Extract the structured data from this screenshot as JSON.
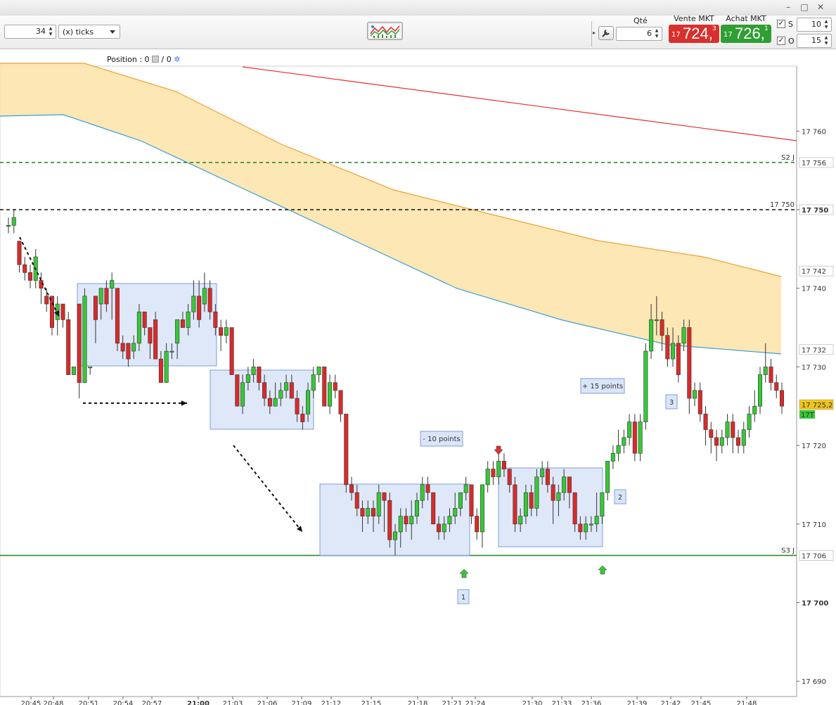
{
  "window": {
    "controls": [
      "–",
      "□",
      "✕"
    ]
  },
  "toolbar": {
    "interval_value": "34",
    "interval_unit": "(x) ticks",
    "qty_label": "Qté",
    "qty_value": "6",
    "sell": {
      "label": "Vente MKT",
      "prefix": "17",
      "main": "724,",
      "sup": "3",
      "color": "#d9302d"
    },
    "buy": {
      "label": "Achat MKT",
      "prefix": "17",
      "main": "726,",
      "sup": "1",
      "color": "#2f9e33"
    },
    "s_label": "S",
    "s_value": "10",
    "o_label": "O",
    "o_value": "15"
  },
  "position": {
    "text": "Position : 0",
    "separator": "/ 0"
  },
  "chart_data": {
    "type": "candlestick",
    "y_ticks": [
      17760,
      17750,
      17740,
      17730,
      17720,
      17710,
      17700,
      17690
    ],
    "y_tick_labels": [
      "17 760",
      "17 750",
      "17 740",
      "17 730",
      "17 720",
      "17 710",
      "17 700",
      "17 690"
    ],
    "x_tick_labels": [
      "20:45",
      "20:48",
      "20:51",
      "20:54",
      "20:57",
      "21:00",
      "21:03",
      "21:06",
      "21:09",
      "21:12",
      "21:15",
      "21:18",
      "21:21",
      "21:24",
      "21:30",
      "21:33",
      "21:36",
      "21:39",
      "21:42",
      "21:45",
      "21:48"
    ],
    "levels": [
      {
        "name": "S2 J",
        "value": 17756,
        "tag": "17 756",
        "color": "#2e8b2e",
        "style": "dashed"
      },
      {
        "name": "17 750",
        "value": 17750,
        "tag": "17 750",
        "color": "#111111",
        "style": "dashed"
      },
      {
        "name": "S3 J",
        "value": 17706,
        "tag": "17 706",
        "color": "#2e8b2e",
        "style": "solid"
      }
    ],
    "band_tags": [
      {
        "text": "17 742",
        "color": "#e8a33a"
      },
      {
        "text": "17 732",
        "color": "#3aa0d8"
      }
    ],
    "price_tag": {
      "text": "17 725,2",
      "sub": "17T"
    },
    "annotations": [
      "- 10 points",
      "+ 15 points",
      "1",
      "2",
      "3"
    ],
    "candles": [
      [
        17748,
        17748,
        17749,
        17747
      ],
      [
        17748,
        17749,
        17750,
        17747
      ],
      [
        17746,
        17743,
        17746,
        17742
      ],
      [
        17743,
        17742,
        17744,
        17741
      ],
      [
        17742,
        17741,
        17743,
        17740
      ],
      [
        17741,
        17744,
        17745,
        17740
      ],
      [
        17741,
        17740,
        17742,
        17738
      ],
      [
        17739,
        17738,
        17740,
        17737
      ],
      [
        17739,
        17735,
        17739,
        17734
      ],
      [
        17736,
        17738,
        17739,
        17734
      ],
      [
        17738,
        17736,
        17738,
        17735
      ],
      [
        17736,
        17729,
        17737,
        17729
      ],
      [
        17729,
        17730,
        17730,
        17729
      ],
      [
        17738,
        17728,
        17738,
        17726
      ],
      [
        17728,
        17739,
        17740,
        17728
      ],
      [
        17730,
        17730,
        17730,
        17729
      ],
      [
        17739,
        17736,
        17739,
        17733
      ],
      [
        17738,
        17740,
        17740,
        17736
      ],
      [
        17740,
        17738,
        17741,
        17737
      ],
      [
        17740,
        17741,
        17742,
        17736
      ],
      [
        17740,
        17733,
        17740,
        17732
      ],
      [
        17733,
        17732,
        17734,
        17731
      ],
      [
        17733,
        17731,
        17733,
        17730
      ],
      [
        17732,
        17733,
        17734,
        17731
      ],
      [
        17733,
        17737,
        17738,
        17732
      ],
      [
        17737,
        17735,
        17737,
        17734
      ],
      [
        17735,
        17733,
        17735,
        17731
      ],
      [
        17736,
        17731,
        17737,
        17731
      ],
      [
        17731,
        17728,
        17732,
        17728
      ],
      [
        17728,
        17732,
        17733,
        17728
      ],
      [
        17732,
        17732,
        17733,
        17731
      ],
      [
        17733,
        17736,
        17736,
        17731
      ],
      [
        17736,
        17735,
        17737,
        17735
      ],
      [
        17735,
        17737,
        17738,
        17734
      ],
      [
        17737,
        17739,
        17741,
        17736
      ],
      [
        17739,
        17736,
        17741,
        17735
      ],
      [
        17738,
        17740,
        17742,
        17737
      ],
      [
        17740,
        17737,
        17741,
        17736
      ],
      [
        17737,
        17735,
        17738,
        17734
      ],
      [
        17735,
        17734,
        17736,
        17732
      ],
      [
        17734,
        17735,
        17736,
        17733
      ],
      [
        17735,
        17729,
        17735,
        17729
      ],
      [
        17729,
        17725,
        17729,
        17725
      ],
      [
        17725,
        17728,
        17729,
        17724
      ],
      [
        17728,
        17729,
        17730,
        17727
      ],
      [
        17729,
        17730,
        17731,
        17728
      ],
      [
        17730,
        17728,
        17730,
        17727
      ],
      [
        17728,
        17726,
        17729,
        17725
      ],
      [
        17726,
        17725,
        17727,
        17724
      ],
      [
        17725,
        17726,
        17728,
        17725
      ],
      [
        17726,
        17727,
        17728,
        17725
      ],
      [
        17727,
        17728,
        17729,
        17726
      ],
      [
        17728,
        17726,
        17729,
        17726
      ],
      [
        17726,
        17724,
        17727,
        17723
      ],
      [
        17724,
        17723,
        17725,
        17722
      ],
      [
        17724,
        17727,
        17728,
        17723
      ],
      [
        17727,
        17729,
        17730,
        17726
      ],
      [
        17729,
        17730,
        17730,
        17728
      ],
      [
        17730,
        17725,
        17730,
        17725
      ],
      [
        17725,
        17728,
        17729,
        17724
      ],
      [
        17728,
        17727,
        17729,
        17726
      ],
      [
        17727,
        17724,
        17727,
        17723
      ],
      [
        17724,
        17715,
        17724,
        17714
      ],
      [
        17715,
        17714,
        17716,
        17713
      ],
      [
        17714,
        17712,
        17715,
        17711
      ],
      [
        17712,
        17711,
        17713,
        17709
      ],
      [
        17711,
        17712,
        17713,
        17710
      ],
      [
        17712,
        17711,
        17713,
        17709
      ],
      [
        17711,
        17714,
        17715,
        17710
      ],
      [
        17714,
        17713,
        17714,
        17709
      ],
      [
        17713,
        17708,
        17714,
        17707
      ],
      [
        17708,
        17709,
        17710,
        17706
      ],
      [
        17709,
        17711,
        17712,
        17707
      ],
      [
        17711,
        17710,
        17712,
        17709
      ],
      [
        17710,
        17711,
        17713,
        17708
      ],
      [
        17711,
        17713,
        17714,
        17710
      ],
      [
        17713,
        17715,
        17716,
        17712
      ],
      [
        17715,
        17714,
        17716,
        17713
      ],
      [
        17714,
        17710,
        17714,
        17710
      ],
      [
        17710,
        17709,
        17711,
        17708
      ],
      [
        17709,
        17710,
        17711,
        17708
      ],
      [
        17710,
        17711,
        17712,
        17709
      ],
      [
        17711,
        17712,
        17714,
        17710
      ],
      [
        17712,
        17714,
        17714,
        17711
      ],
      [
        17714,
        17715,
        17716,
        17713
      ],
      [
        17715,
        17711,
        17715,
        17710
      ],
      [
        17711,
        17709,
        17712,
        17708
      ],
      [
        17709,
        17715,
        17715,
        17707
      ],
      [
        17715,
        17717,
        17718,
        17714
      ],
      [
        17717,
        17716,
        17718,
        17715
      ],
      [
        17716,
        17718,
        17719,
        17715
      ],
      [
        17718,
        17717,
        17719,
        17716
      ],
      [
        17717,
        17715,
        17717,
        17714
      ],
      [
        17715,
        17710,
        17716,
        17709
      ],
      [
        17710,
        17711,
        17712,
        17709
      ],
      [
        17711,
        17714,
        17715,
        17710
      ],
      [
        17714,
        17712,
        17715,
        17711
      ],
      [
        17712,
        17716,
        17717,
        17711
      ],
      [
        17716,
        17717,
        17718,
        17715
      ],
      [
        17717,
        17715,
        17718,
        17714
      ],
      [
        17715,
        17713,
        17716,
        17710
      ],
      [
        17713,
        17714,
        17715,
        17711
      ],
      [
        17714,
        17716,
        17717,
        17713
      ],
      [
        17716,
        17714,
        17716,
        17712
      ],
      [
        17714,
        17710,
        17714,
        17709
      ],
      [
        17710,
        17709,
        17711,
        17708
      ],
      [
        17709,
        17710,
        17711,
        17708
      ],
      [
        17710,
        17710,
        17711,
        17709
      ],
      [
        17710,
        17711,
        17714,
        17709
      ],
      [
        17711,
        17714,
        17714,
        17710
      ],
      [
        17714,
        17718,
        17718,
        17713
      ],
      [
        17718,
        17719,
        17720,
        17717
      ],
      [
        17719,
        17720,
        17722,
        17718
      ],
      [
        17720,
        17721,
        17722,
        17719
      ],
      [
        17721,
        17723,
        17724,
        17720
      ],
      [
        17723,
        17719,
        17724,
        17718
      ],
      [
        17719,
        17723,
        17724,
        17718
      ],
      [
        17723,
        17732,
        17733,
        17722
      ],
      [
        17732,
        17736,
        17738,
        17731
      ],
      [
        17736,
        17736,
        17739,
        17734
      ],
      [
        17736,
        17734,
        17737,
        17732
      ],
      [
        17734,
        17731,
        17735,
        17730
      ],
      [
        17731,
        17733,
        17735,
        17730
      ],
      [
        17733,
        17729,
        17734,
        17728
      ],
      [
        17733,
        17735,
        17736,
        17732
      ],
      [
        17735,
        17726,
        17736,
        17724
      ],
      [
        17726,
        17727,
        17728,
        17725
      ],
      [
        17727,
        17724,
        17728,
        17723
      ],
      [
        17724,
        17722,
        17725,
        17720
      ],
      [
        17722,
        17721,
        17723,
        17719
      ],
      [
        17721,
        17720,
        17722,
        17718
      ],
      [
        17720,
        17721,
        17722,
        17719
      ],
      [
        17721,
        17723,
        17724,
        17720
      ],
      [
        17723,
        17721,
        17724,
        17719
      ],
      [
        17721,
        17720,
        17722,
        17719
      ],
      [
        17720,
        17722,
        17723,
        17719
      ],
      [
        17722,
        17724,
        17725,
        17721
      ],
      [
        17724,
        17725,
        17727,
        17723
      ],
      [
        17725,
        17729,
        17730,
        17724
      ],
      [
        17729,
        17730,
        17733,
        17728
      ],
      [
        17730,
        17728,
        17731,
        17727
      ],
      [
        17728,
        17727,
        17729,
        17726
      ],
      [
        17727,
        17725,
        17728,
        17724
      ]
    ]
  }
}
